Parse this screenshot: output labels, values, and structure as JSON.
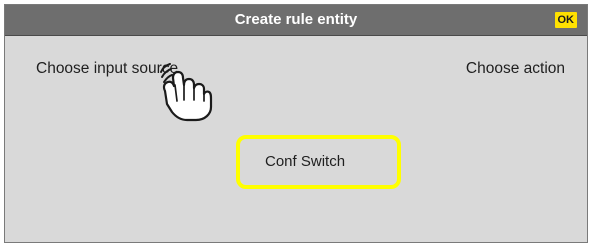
{
  "dialog": {
    "title": "Create rule entity",
    "ok_label": "OK"
  },
  "panels": {
    "input_source_label": "Choose input source",
    "action_label": "Choose action"
  },
  "selection": {
    "label": "Conf Switch"
  },
  "icons": {
    "pointer": "hand-pointer-icon"
  },
  "colors": {
    "titlebar": "#6e6e6e",
    "dialog_background": "#d9d9d9",
    "ok_button": "#ffe100",
    "highlight": "#ffff00"
  }
}
